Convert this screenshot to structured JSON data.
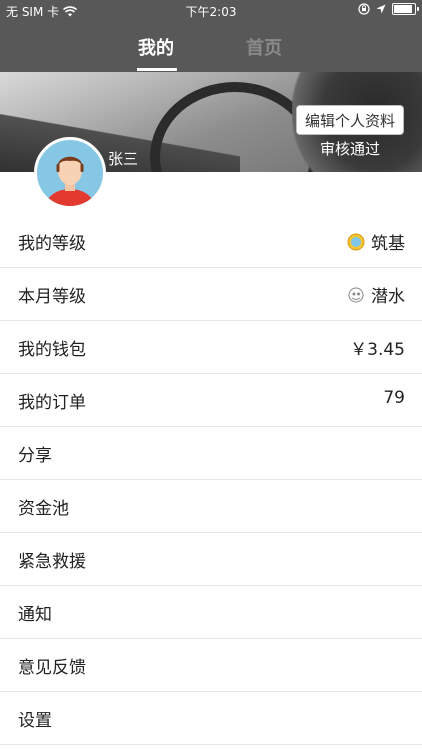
{
  "status_bar": {
    "carrier": "无 SIM 卡",
    "time": "下午2:03"
  },
  "tabs": {
    "mine": "我的",
    "home": "首页"
  },
  "profile": {
    "edit_button": "编辑个人资料",
    "review_status": "审核通过",
    "username": "张三"
  },
  "menu": {
    "my_level": {
      "label": "我的等级",
      "value": "筑基",
      "icon": "gold-coin-icon"
    },
    "monthly_level": {
      "label": "本月等级",
      "value": "潜水",
      "icon": "diver-icon"
    },
    "wallet": {
      "label": "我的钱包",
      "value": "￥3.45"
    },
    "orders": {
      "label": "我的订单",
      "value": "79"
    },
    "share": {
      "label": "分享"
    },
    "fund_pool": {
      "label": "资金池"
    },
    "emergency": {
      "label": "紧急救援"
    },
    "notice": {
      "label": "通知"
    },
    "feedback": {
      "label": "意见反馈"
    },
    "settings": {
      "label": "设置"
    }
  },
  "colors": {
    "header_bg": "#585858",
    "tab_active": "#ffffff",
    "tab_inactive": "#8a8a8a",
    "avatar_bg": "#86c7e6",
    "divider": "#e6e6e6"
  }
}
